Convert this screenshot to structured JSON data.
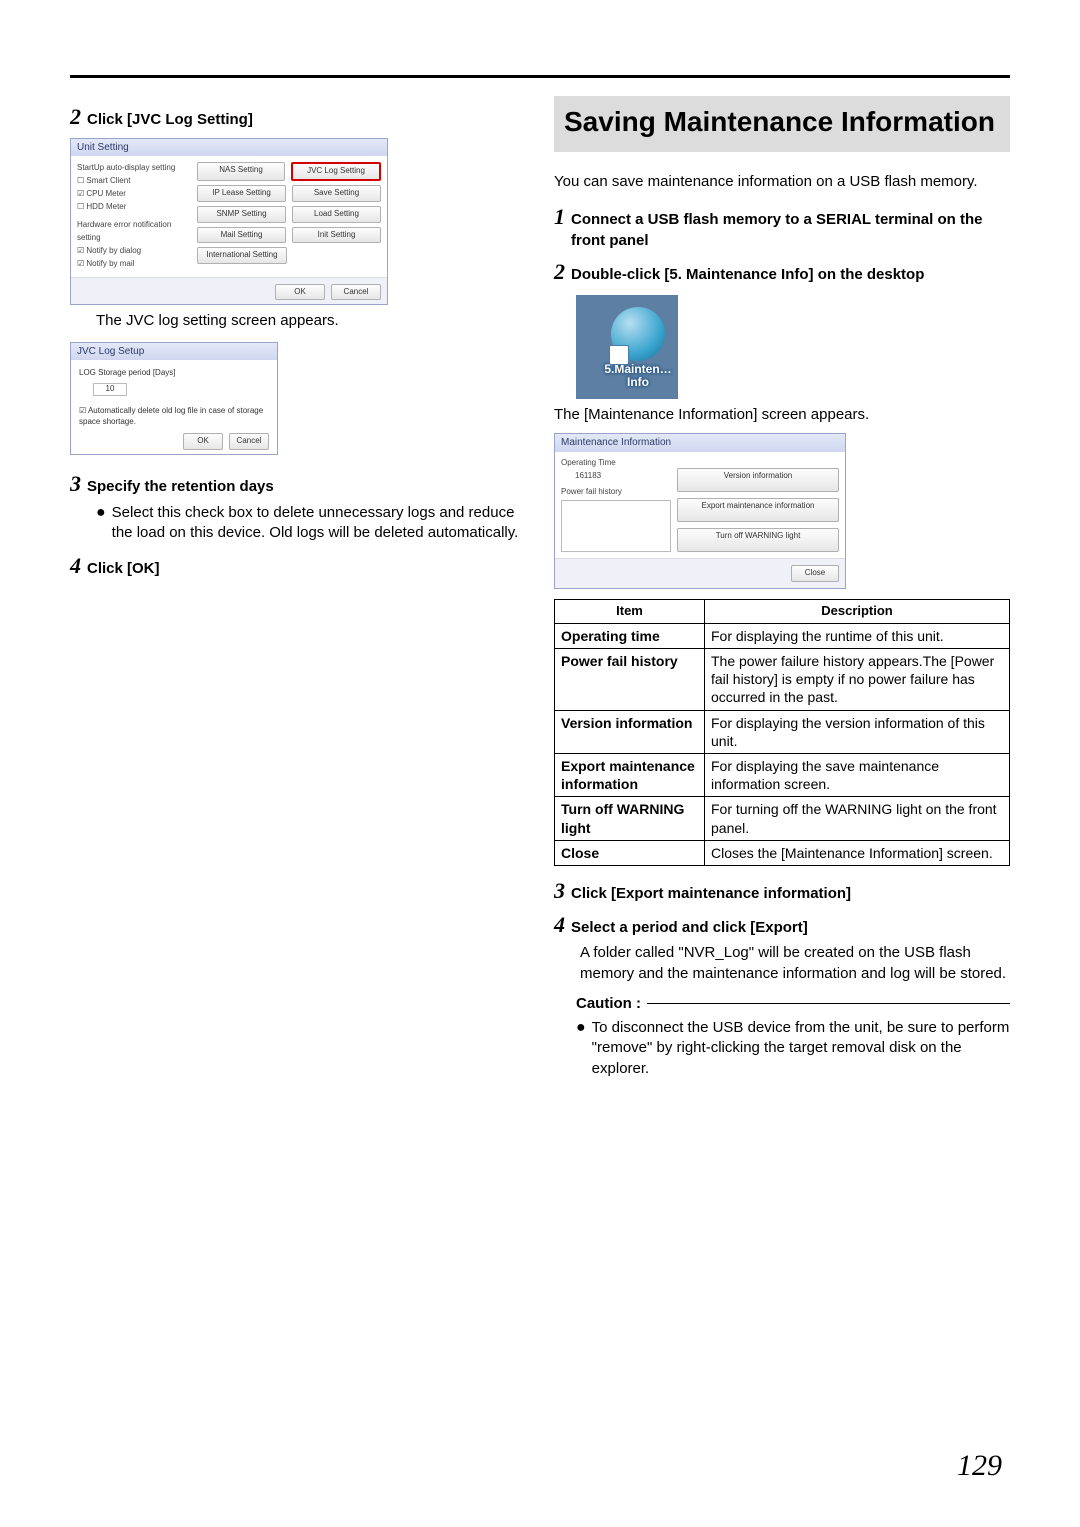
{
  "left": {
    "step2": "Click [JVC Log Setting]",
    "mock1": {
      "title": "Unit Setting",
      "left_labels": {
        "auto": "StartUp auto-display setting",
        "smart": "Smart Client",
        "cpu": "CPU Meter",
        "hdd": "HDD Meter",
        "hw": "Hardware error notification setting",
        "nd": "Notify by dialog",
        "nm": "Notify by mail"
      },
      "btns": {
        "nas": "NAS Setting",
        "lease": "IP Lease Setting",
        "snmp": "SNMP Setting",
        "mail": "Mail Setting",
        "intl": "International Setting",
        "jvclog": "JVC Log Setting",
        "save": "Save Setting",
        "load": "Load Setting",
        "init": "Init Setting",
        "ok": "OK",
        "cancel": "Cancel"
      }
    },
    "caption_after_mock1": "The JVC log setting screen appears.",
    "mock2": {
      "title": "JVC Log Setup",
      "label": "LOG Storage period [Days]",
      "value": "10",
      "checkbox": "Automatically delete old log file in case of storage space shortage.",
      "ok": "OK",
      "cancel": "Cancel"
    },
    "step3": "Specify the retention days",
    "bullet3": "Select this check box to delete unnecessary logs and reduce the load on this device. Old logs will be deleted automatically.",
    "step4": "Click [OK]"
  },
  "right": {
    "heading": "Saving Maintenance Information",
    "intro": "You can save maintenance information on a USB flash memory.",
    "step1": "Connect a USB flash memory to a SERIAL terminal on the front panel",
    "step2": "Double-click [5. Maintenance Info] on the desktop",
    "icon_label1": "5.Mainten…",
    "icon_label2": "Info",
    "caption_mi": "The [Maintenance Information] screen appears.",
    "mock3": {
      "title": "Maintenance Information",
      "op_label": "Operating Time",
      "op_value": "161183",
      "pf_label": "Power fail history",
      "btn_ver": "Version information",
      "btn_exp": "Export maintenance information",
      "btn_warn": "Turn off WARNING light",
      "close": "Close"
    },
    "table": {
      "h1": "Item",
      "h2": "Description",
      "rows": [
        {
          "item": "Operating time",
          "desc": "For displaying the runtime of this unit."
        },
        {
          "item": "Power fail history",
          "desc": "The power failure history appears.The [Power fail history] is empty if no power failure has occurred in the past."
        },
        {
          "item": "Version information",
          "desc": "For displaying the version information of this unit."
        },
        {
          "item": "Export maintenance information",
          "desc": "For displaying the save maintenance information screen."
        },
        {
          "item": "Turn off WARNING light",
          "desc": "For turning off the WARNING light on the front panel."
        },
        {
          "item": "Close",
          "desc": "Closes the [Maintenance Information] screen."
        }
      ]
    },
    "step3": "Click [Export maintenance information]",
    "step4": "Select a period and click [Export]",
    "step4_body": "A folder called \"NVR_Log\" will be created on the USB flash memory and the maintenance information and log will be stored.",
    "caution_label": "Caution :",
    "caution_bullet": "To disconnect the USB device from the unit, be sure to perform \"remove\" by right-clicking the target removal disk on the explorer."
  },
  "page_number": "129"
}
